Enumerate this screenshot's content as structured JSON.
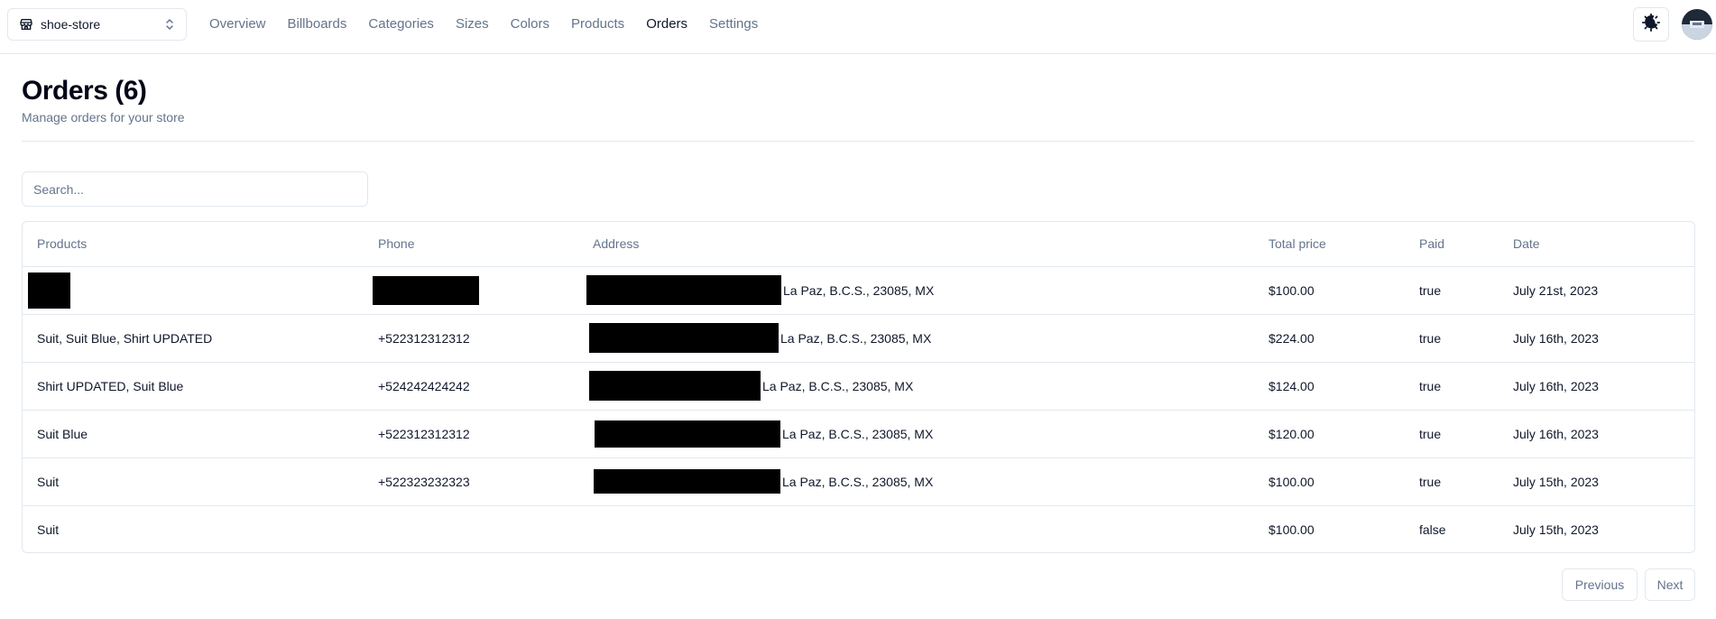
{
  "store_switcher": {
    "name": "shoe-store"
  },
  "nav": [
    {
      "label": "Overview",
      "active": false
    },
    {
      "label": "Billboards",
      "active": false
    },
    {
      "label": "Categories",
      "active": false
    },
    {
      "label": "Sizes",
      "active": false
    },
    {
      "label": "Colors",
      "active": false
    },
    {
      "label": "Products",
      "active": false
    },
    {
      "label": "Orders",
      "active": true
    },
    {
      "label": "Settings",
      "active": false
    }
  ],
  "header": {
    "title": "Orders (6)",
    "subtitle": "Manage orders for your store"
  },
  "search": {
    "placeholder": "Search..."
  },
  "table": {
    "columns": [
      "Products",
      "Phone",
      "Address",
      "Total price",
      "Paid",
      "Date"
    ],
    "rows": [
      {
        "products": "",
        "phone": "",
        "address": "La Paz, B.C.S., 23085, MX",
        "total": "$100.00",
        "paid": "true",
        "date": "July 21st, 2023"
      },
      {
        "products": "Suit, Suit Blue, Shirt UPDATED",
        "phone": "+522312312312",
        "address": "La Paz, B.C.S., 23085, MX",
        "total": "$224.00",
        "paid": "true",
        "date": "July 16th, 2023"
      },
      {
        "products": "Shirt UPDATED, Suit Blue",
        "phone": "+524242424242",
        "address": "La Paz, B.C.S., 23085, MX",
        "total": "$124.00",
        "paid": "true",
        "date": "July 16th, 2023"
      },
      {
        "products": "Suit Blue",
        "phone": "+522312312312",
        "address": "La Paz, B.C.S., 23085, MX",
        "total": "$120.00",
        "paid": "true",
        "date": "July 16th, 2023"
      },
      {
        "products": "Suit",
        "phone": "+522323232323",
        "address": "La Paz, B.C.S., 23085, MX",
        "total": "$100.00",
        "paid": "true",
        "date": "July 15th, 2023"
      },
      {
        "products": "Suit",
        "phone": "",
        "address": "",
        "total": "$100.00",
        "paid": "false",
        "date": "July 15th, 2023"
      }
    ]
  },
  "pagination": {
    "previous": "Previous",
    "next": "Next"
  }
}
